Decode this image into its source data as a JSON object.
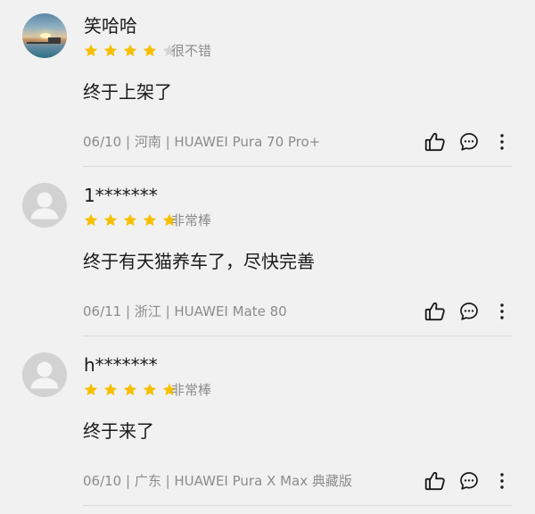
{
  "colors": {
    "background": "#f1f1f1",
    "star_filled": "#f6c000",
    "star_empty": "#d4d4d4",
    "text_primary": "#1a1a1a",
    "text_secondary": "#8c8c8c",
    "divider": "#dcdcdc"
  },
  "icons": {
    "like": "thumbs-up-icon",
    "comment": "comment-bubble-icon",
    "more": "more-vertical-icon",
    "star": "star-icon"
  },
  "reviews": [
    {
      "username": "笑哈哈",
      "avatar": "scenic-sunset-avatar",
      "rating": 4,
      "max_rating": 5,
      "rating_text": "很不错",
      "content": "终于上架了",
      "meta": "06/10 | 河南 | HUAWEI Pura 70 Pro+"
    },
    {
      "username": "1*******",
      "avatar": "default-user-avatar",
      "rating": 5,
      "max_rating": 5,
      "rating_text": "非常棒",
      "content": "终于有天猫养车了，尽快完善",
      "meta": "06/11 | 浙江 | HUAWEI Mate 80"
    },
    {
      "username": "h*******",
      "avatar": "default-user-avatar",
      "rating": 5,
      "max_rating": 5,
      "rating_text": "非常棒",
      "content": "终于来了",
      "meta": "06/10 | 广东 | HUAWEI Pura X Max 典藏版"
    }
  ]
}
